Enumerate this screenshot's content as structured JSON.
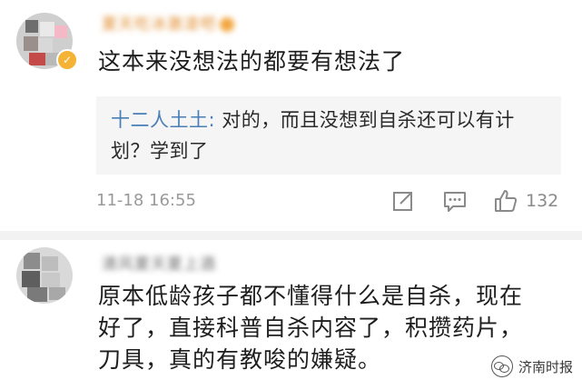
{
  "comment1": {
    "username": "夏天吃冰激凌吧",
    "text": "这本来没想法的都要有想法了",
    "reply": {
      "user": "十二人土土:",
      "text": " 对的，而且没想到自杀还可以有计划？学到了"
    },
    "time": "11-18 16:55",
    "likes": "132",
    "badge": "✓"
  },
  "comment2": {
    "username": "清风夏天夏上酒",
    "text_line1": "原本低龄孩子都不懂得什么是自杀，现在",
    "text_line2": "好了，直接科普自杀内容了，积攒药片，",
    "text_line3": "刀具，真的有教唆的嫌疑。"
  },
  "watermark": {
    "label": "济南时报"
  },
  "colors": {
    "reply_user": "#4a7eb8",
    "meta": "#9a9a9a",
    "verified_badge": "#f5b335"
  },
  "icons": [
    "share-icon",
    "comment-icon",
    "like-icon",
    "wechat-icon"
  ]
}
